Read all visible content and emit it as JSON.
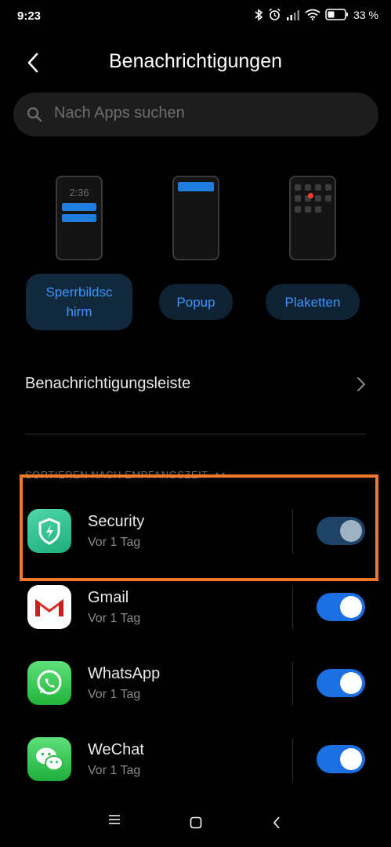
{
  "status_bar": {
    "time": "9:23",
    "battery": "33 %"
  },
  "header": {
    "title": "Benachrichtigungen"
  },
  "search": {
    "placeholder": "Nach Apps suchen"
  },
  "preview": {
    "lockscreen_time": "2:36"
  },
  "styles": [
    {
      "label": "Sperrbildsc\nhirm",
      "selected": true
    },
    {
      "label": "Popup",
      "selected": false
    },
    {
      "label": "Plaketten",
      "selected": false
    }
  ],
  "notification_bar": {
    "label": "Benachrichtigungsleiste"
  },
  "section": {
    "label": "SORTIEREN NACH EMPFANGSZEIT"
  },
  "apps": [
    {
      "name": "Security",
      "time": "Vor 1 Tag",
      "enabled": true
    },
    {
      "name": "Gmail",
      "time": "Vor 1 Tag",
      "enabled": true
    },
    {
      "name": "WhatsApp",
      "time": "Vor 1 Tag",
      "enabled": true
    },
    {
      "name": "WeChat",
      "time": "Vor 1 Tag",
      "enabled": true
    }
  ],
  "colors": {
    "accent": "#1b6fe0",
    "highlight": "#f07a2a",
    "background": "#000000"
  }
}
